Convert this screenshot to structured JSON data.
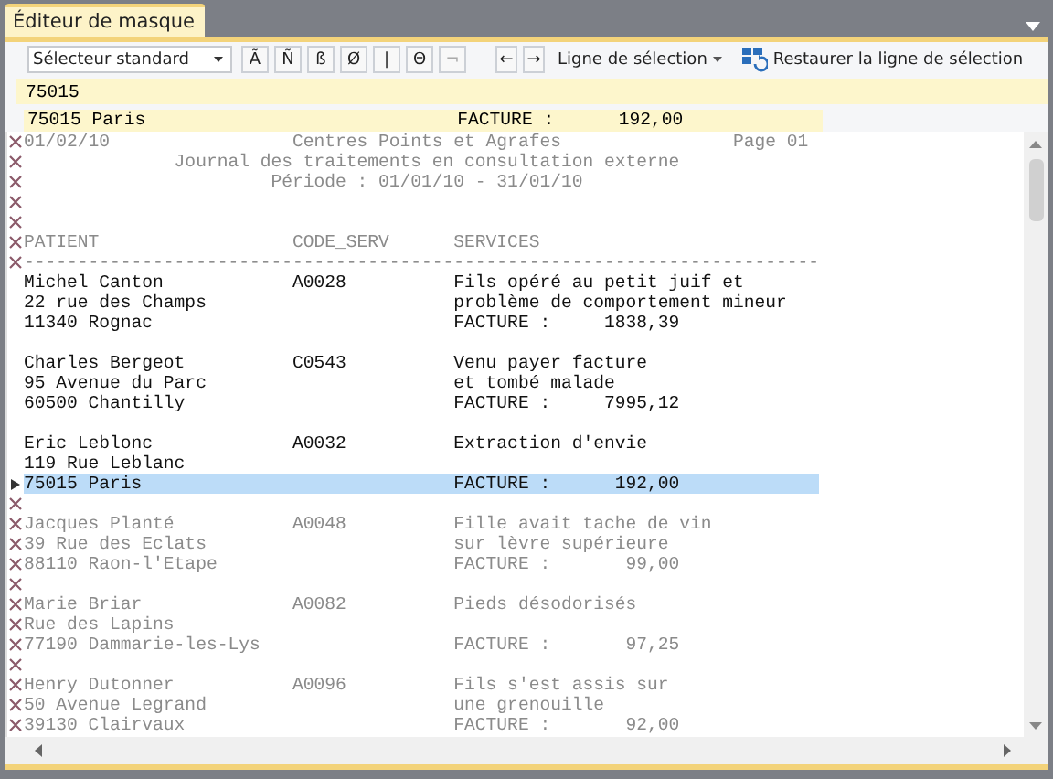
{
  "tab": {
    "label": "Éditeur de masque",
    "selected": true
  },
  "toolbar": {
    "selector": "Sélecteur standard",
    "char_buttons": [
      {
        "label": "Ã",
        "disabled": false
      },
      {
        "label": "Ñ",
        "disabled": false
      },
      {
        "label": "ß",
        "disabled": false
      },
      {
        "label": "Ø",
        "disabled": false
      },
      {
        "label": "|",
        "disabled": false
      },
      {
        "label": "Θ",
        "disabled": false
      },
      {
        "label": "¬",
        "disabled": true
      }
    ],
    "nav_buttons": [
      "←",
      "→"
    ],
    "selection_menu": "Ligne de sélection",
    "restore_button": "Restaurer la ligne de sélection"
  },
  "mask_input": {
    "value": "75015"
  },
  "preview_line": "75015 Paris                             FACTURE :      192,00",
  "lines": [
    {
      "kind": "excluded",
      "text": "01/02/10                 Centres Points et Agrafes                Page 01"
    },
    {
      "kind": "excluded",
      "text": "              Journal des traitements en consultation externe"
    },
    {
      "kind": "excluded",
      "text": "                       Période : 01/01/10 - 31/01/10"
    },
    {
      "kind": "excluded"
    },
    {
      "kind": "excluded"
    },
    {
      "kind": "excluded",
      "text": "PATIENT                  CODE_SERV      SERVICES"
    },
    {
      "kind": "excluded",
      "text": "--------------------------------------------------------------------------"
    },
    {
      "kind": "included",
      "text": "Michel Canton            A0028          Fils opéré au petit juif et"
    },
    {
      "kind": "included",
      "text": "22 rue des Champs                       problème de comportement mineur"
    },
    {
      "kind": "included",
      "text": "11340 Rognac                            FACTURE :     1838,39"
    },
    {
      "kind": "included"
    },
    {
      "kind": "included",
      "text": "Charles Bergeot          C0543          Venu payer facture"
    },
    {
      "kind": "included",
      "text": "95 Avenue du Parc                       et tombé malade"
    },
    {
      "kind": "included",
      "text": "60500 Chantilly                         FACTURE :     7995,12"
    },
    {
      "kind": "included"
    },
    {
      "kind": "included",
      "text": "Eric Leblonc             A0032          Extraction d'envie"
    },
    {
      "kind": "included",
      "text": "119 Rue Leblanc"
    },
    {
      "kind": "current",
      "text": "75015 Paris                             FACTURE :      192,00"
    },
    {
      "kind": "excluded"
    },
    {
      "kind": "excluded",
      "text": "Jacques Planté           A0048          Fille avait tache de vin"
    },
    {
      "kind": "excluded",
      "text": "39 Rue des Eclats                       sur lèvre supérieure"
    },
    {
      "kind": "excluded",
      "text": "88110 Raon-l'Etape                      FACTURE :       99,00"
    },
    {
      "kind": "excluded"
    },
    {
      "kind": "excluded",
      "text": "Marie Briar              A0082          Pieds désodorisés"
    },
    {
      "kind": "excluded",
      "text": "Rue des Lapins"
    },
    {
      "kind": "excluded",
      "text": "77190 Dammarie-les-Lys                  FACTURE :       97,25"
    },
    {
      "kind": "excluded"
    },
    {
      "kind": "excluded",
      "text": "Henry Dutonner           A0096          Fils s'est assis sur"
    },
    {
      "kind": "excluded",
      "text": "50 Avenue Legrand                       une grenouille"
    },
    {
      "kind": "excluded",
      "text": "39130 Clairvaux                         FACTURE :       92,00"
    }
  ]
}
